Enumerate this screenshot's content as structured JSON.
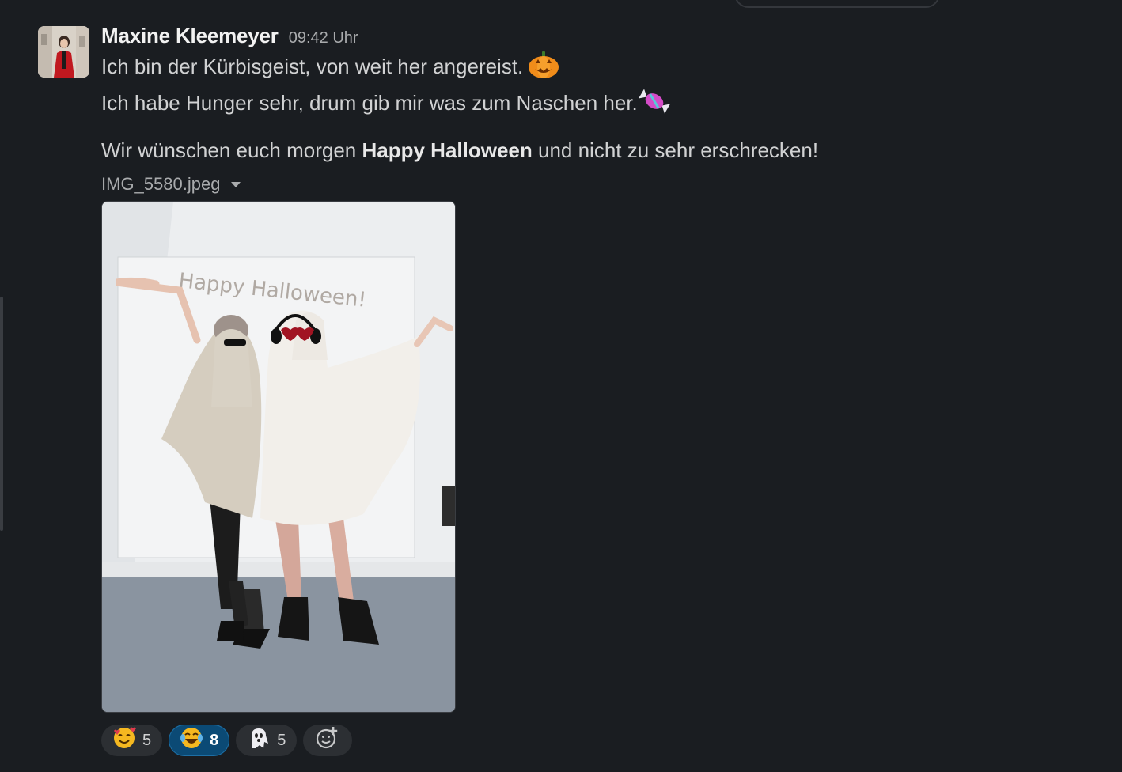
{
  "message": {
    "author": "Maxine Kleemeyer",
    "timestamp": "09:42 Uhr",
    "lines": [
      "Ich bin der Kürbisgeist, von weit her angereist.",
      "Ich habe Hunger sehr, drum gib mir was zum Naschen her."
    ],
    "line1_emoji": "jack-o-lantern",
    "line2_emoji": "candy",
    "wish_prefix": "Wir wünschen euch morgen ",
    "wish_bold": "Happy Halloween",
    "wish_suffix": " und nicht zu sehr erschrecken!",
    "attachment": {
      "filename": "IMG_5580.jpeg",
      "image_caption": "Happy Halloween!"
    }
  },
  "reactions": [
    {
      "emoji": "smiling-face-with-hearts",
      "count": "5",
      "active": false
    },
    {
      "emoji": "face-with-tears-of-joy",
      "count": "8",
      "active": true
    },
    {
      "emoji": "ghost",
      "count": "5",
      "active": false
    }
  ],
  "add_reaction_icon": "add-emoji-icon",
  "colors": {
    "background": "#1a1d21",
    "text": "#d1d2d3",
    "muted": "#a9abad",
    "active_reaction": "#0b4a75"
  }
}
